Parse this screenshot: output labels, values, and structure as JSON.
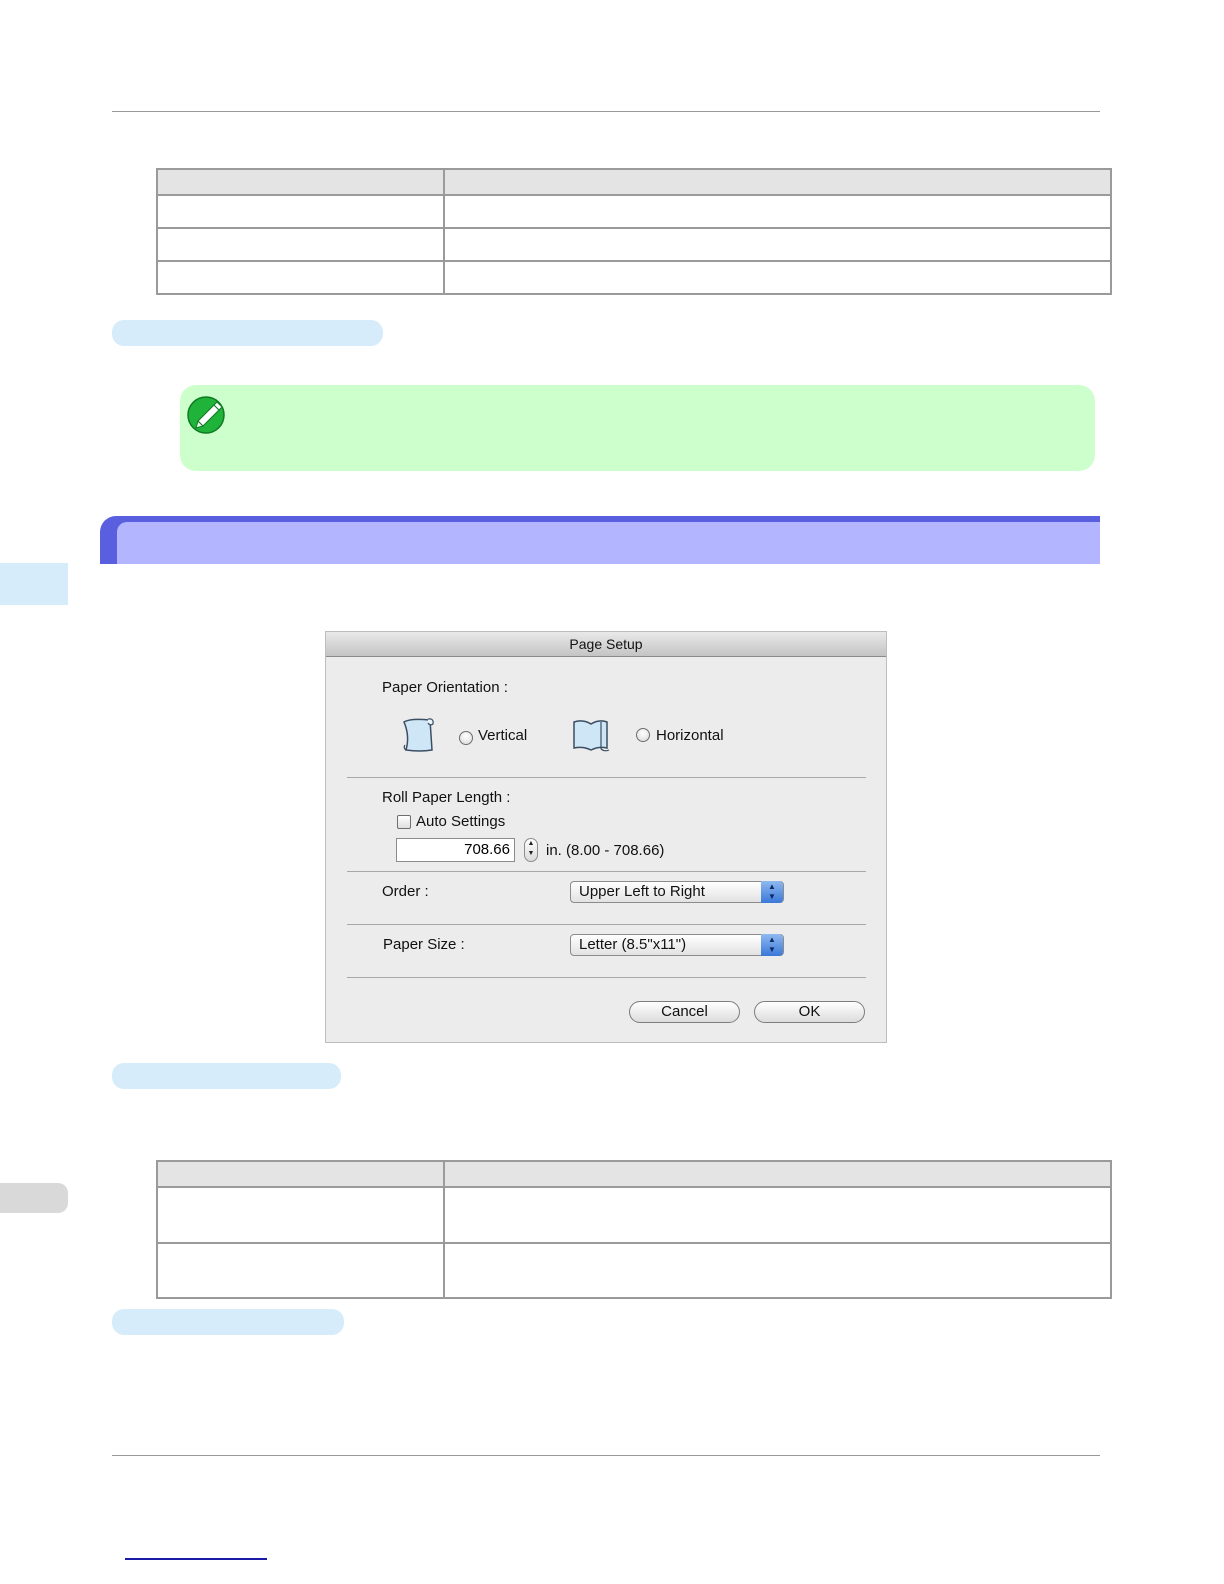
{
  "colors": {
    "note_bg": "#ccffcc",
    "section_bar": "#5a5fe0",
    "section_fill": "#b3b6ff",
    "pill": "#d6ecfb"
  },
  "note": {
    "icon": "pencil-note-icon"
  },
  "dialog": {
    "title": "Page Setup",
    "paper_orientation": {
      "label": "Paper Orientation :",
      "vertical_label": "Vertical",
      "horizontal_label": "Horizontal",
      "vertical_icon": "portrait-roll-icon",
      "horizontal_icon": "landscape-roll-icon"
    },
    "roll_paper_length": {
      "label": "Roll Paper Length :",
      "auto_settings_label": "Auto Settings",
      "value": "708.66",
      "range_text": "in. (8.00 - 708.66)"
    },
    "order": {
      "label": "Order :",
      "selected": "Upper Left to Right"
    },
    "paper_size": {
      "label": "Paper Size :",
      "selected": "Letter (8.5\"x11\")"
    },
    "buttons": {
      "cancel": "Cancel",
      "ok": "OK"
    }
  }
}
